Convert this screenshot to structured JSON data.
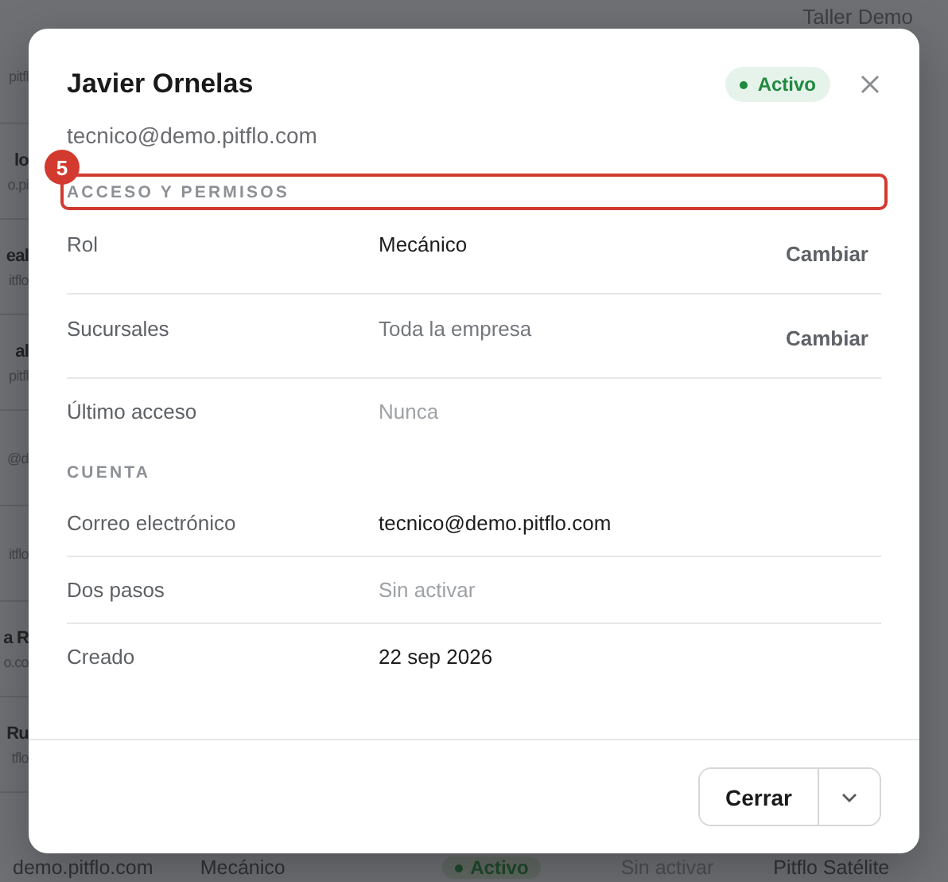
{
  "background": {
    "top_right": "Taller Demo",
    "left_fragments": [
      {
        "email": "pitfl"
      },
      {
        "name": "lo",
        "email": "o.pi"
      },
      {
        "name": "eal",
        "email": "itflo"
      },
      {
        "name": "al",
        "email": "pitfl"
      },
      {
        "email": "@d"
      },
      {
        "email": "itflo"
      },
      {
        "name": "a R",
        "email": "o.co"
      },
      {
        "name": "Ru",
        "email": "tflo"
      }
    ],
    "bottom_row": {
      "email": "demo.pitflo.com",
      "role": "Mecánico",
      "status": "Activo",
      "two_step": "Sin activar",
      "branch": "Pitflo Satélite"
    }
  },
  "dialog": {
    "title": "Javier Ornelas",
    "status": "Activo",
    "subtitle": "tecnico@demo.pitflo.com",
    "sections": [
      {
        "heading": "ACCESO Y PERMISOS",
        "annotation": "5",
        "rows": [
          {
            "label": "Rol",
            "value": "Mecánico",
            "secondary": false,
            "empty": false,
            "action": "Cambiar"
          },
          {
            "label": "Sucursales",
            "value": "Toda la empresa",
            "secondary": true,
            "empty": false,
            "action": "Cambiar"
          },
          {
            "label": "Último acceso",
            "value": "Nunca",
            "secondary": false,
            "empty": true
          }
        ]
      },
      {
        "heading": "CUENTA",
        "rows": [
          {
            "label": "Correo electrónico",
            "value": "tecnico@demo.pitflo.com",
            "secondary": false,
            "empty": false
          },
          {
            "label": "Dos pasos",
            "value": "Sin activar",
            "secondary": false,
            "empty": true
          },
          {
            "label": "Creado",
            "value": "22 sep 2026",
            "secondary": false,
            "empty": false
          }
        ]
      }
    ],
    "footer": {
      "button": "Cerrar"
    }
  }
}
